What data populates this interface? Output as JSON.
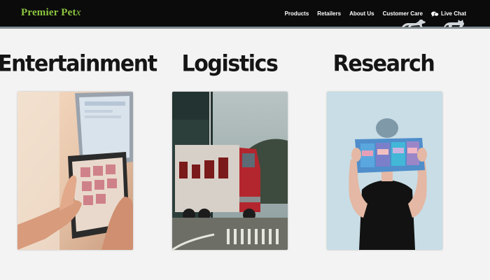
{
  "brand": {
    "name": "Premier Pet",
    "swirl": "x",
    "color": "#8cc63f"
  },
  "nav": {
    "items": [
      {
        "label": "Products"
      },
      {
        "label": "Retailers"
      },
      {
        "label": "About Us"
      },
      {
        "label": "Customer Care"
      }
    ],
    "live_chat": {
      "label": "Live Chat",
      "icon": "chat-bubbles-icon"
    }
  },
  "sections": [
    {
      "title": "Entertainment",
      "image": "hands-using-tablet-photo"
    },
    {
      "title": "Logistics",
      "image": "truck-at-loading-dock-photo"
    },
    {
      "title": "Research",
      "image": "person-holding-samples-photo"
    }
  ],
  "colors": {
    "nav_bg": "#0b0b0b",
    "page_bg": "#f3f3f3",
    "accent": "#8cc63f"
  }
}
